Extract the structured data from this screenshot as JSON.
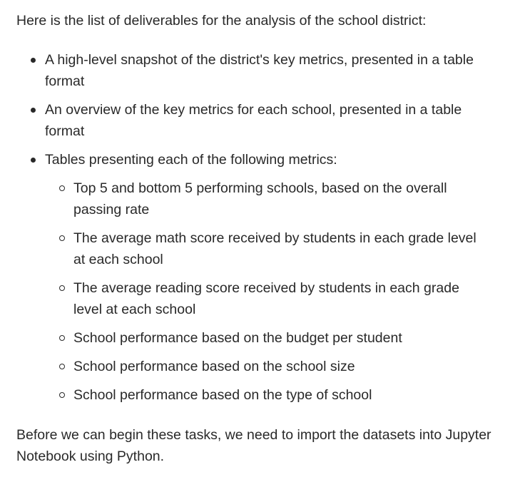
{
  "intro": "Here is the list of deliverables for the analysis of the school district:",
  "deliverables": [
    {
      "text": "A high-level snapshot of the district's key metrics, presented in a table format"
    },
    {
      "text": "An overview of the key metrics for each school, presented in a table format"
    },
    {
      "text": "Tables presenting each of the following metrics:",
      "subitems": [
        "Top 5 and bottom 5 performing schools, based on the overall passing rate",
        "The average math score received by students in each grade level at each school",
        "The average reading score received by students in each grade level at each school",
        "School performance based on the budget per student",
        "School performance based on the school size",
        "School performance based on the type of school"
      ]
    }
  ],
  "outro": "Before we can begin these tasks, we need to import the datasets into Jupyter Notebook using Python."
}
